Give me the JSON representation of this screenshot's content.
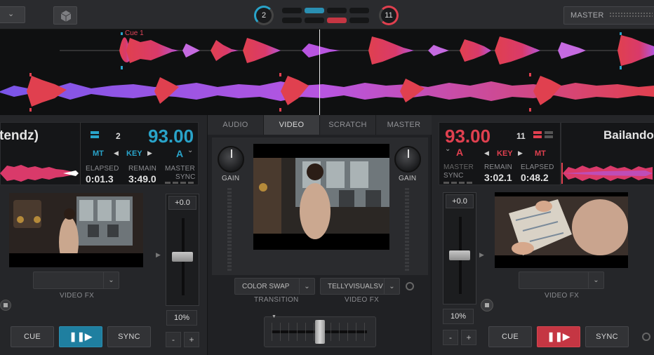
{
  "top": {
    "left_counter": "2",
    "right_counter": "11",
    "master_label": "MASTER"
  },
  "waveform": {
    "cue_label": "Cue 1"
  },
  "left_deck": {
    "title": "tendz)",
    "bpm": "93.00",
    "layer_num": "2",
    "mt": "MT",
    "key_label": "KEY",
    "key_value": "A",
    "elapsed_label": "ELAPSED",
    "elapsed": "0:01.3",
    "remain_label": "REMAIN",
    "remain": "3:49.0",
    "master_label": "MASTER",
    "sync_label": "SYNC",
    "video_fx": "VIDEO FX",
    "pitch": "+0.0",
    "range": "10%",
    "cue": "CUE",
    "sync": "SYNC",
    "minus": "-",
    "plus": "+"
  },
  "right_deck": {
    "title": "Bailando",
    "bpm": "93.00",
    "layer_num": "11",
    "mt": "MT",
    "key_label": "KEY",
    "key_value": "A",
    "master_label": "MASTER",
    "sync_label": "SYNC",
    "remain_label": "REMAIN",
    "remain": "3:02.1",
    "elapsed_label": "ELAPSED",
    "elapsed": "0:48.2",
    "video_fx": "VIDEO FX",
    "pitch": "+0.0",
    "range": "10%",
    "cue": "CUE",
    "sync": "SYNC",
    "minus": "-",
    "plus": "+"
  },
  "center": {
    "tabs": [
      "AUDIO",
      "VIDEO",
      "SCRATCH",
      "MASTER"
    ],
    "gain_left": "GAIN",
    "gain_right": "GAIN",
    "transition_value": "COLOR SWAP",
    "transition_label": "TRANSITION",
    "video_fx_value": "TELLYVISUALSV",
    "video_fx_label": "VIDEO FX"
  },
  "colors": {
    "accent_blue": "#29a3c9",
    "accent_red": "#e0404f"
  }
}
